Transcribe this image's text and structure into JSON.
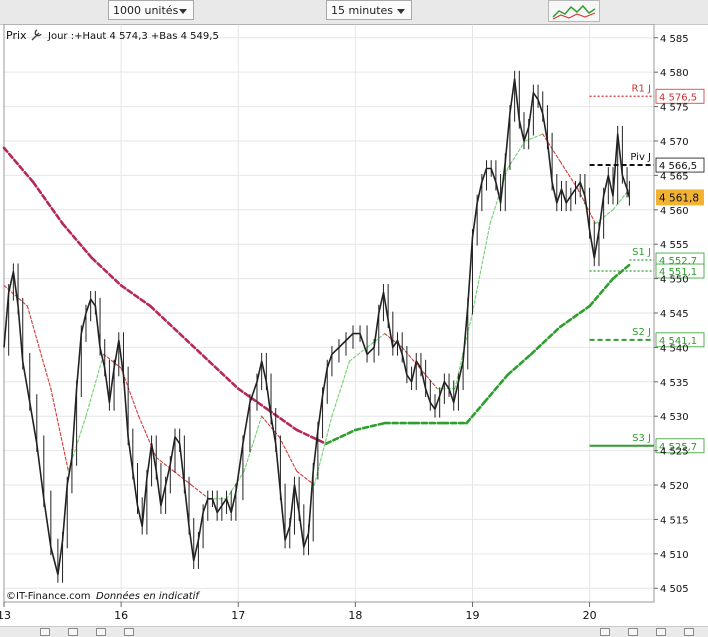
{
  "toolbar": {
    "quantity_select": "1000 unités",
    "interval_select": "15 minutes"
  },
  "chart_data": {
    "type": "candlestick",
    "header": "Jour :+Haut 4 574,3 +Bas 4 549,5",
    "prix_label": "Prix",
    "watermark": "©IT-Finance.com",
    "watermark_note": "Données en indicatif",
    "x_labels": [
      {
        "label": "13",
        "t": 0
      },
      {
        "label": "16",
        "t": 1
      },
      {
        "label": "17",
        "t": 2
      },
      {
        "label": "18",
        "t": 3
      },
      {
        "label": "19",
        "t": 4
      },
      {
        "label": "20",
        "t": 5
      }
    ],
    "x_range": [
      0,
      5.55
    ],
    "y_range": [
      4503,
      4587
    ],
    "y_ticks": [
      "4 505",
      "4 510",
      "4 515",
      "4 520",
      "4 525",
      "4 530",
      "4 535",
      "4 540",
      "4 545",
      "4 550",
      "4 555",
      "4 560",
      "4 565",
      "4 570",
      "4 575",
      "4 580",
      "4 585"
    ],
    "y_tick_values": [
      4505,
      4510,
      4515,
      4520,
      4525,
      4530,
      4535,
      4540,
      4545,
      4550,
      4555,
      4560,
      4565,
      4570,
      4575,
      4580,
      4585
    ],
    "price_path": [
      [
        0.0,
        4540
      ],
      [
        0.04,
        4548
      ],
      [
        0.08,
        4551
      ],
      [
        0.12,
        4546
      ],
      [
        0.16,
        4538
      ],
      [
        0.22,
        4532
      ],
      [
        0.28,
        4526
      ],
      [
        0.34,
        4518
      ],
      [
        0.4,
        4511
      ],
      [
        0.46,
        4507
      ],
      [
        0.5,
        4512
      ],
      [
        0.54,
        4520
      ],
      [
        0.58,
        4524
      ],
      [
        0.62,
        4534
      ],
      [
        0.66,
        4542
      ],
      [
        0.7,
        4545
      ],
      [
        0.74,
        4547
      ],
      [
        0.78,
        4546
      ],
      [
        0.82,
        4540
      ],
      [
        0.86,
        4537
      ],
      [
        0.9,
        4532
      ],
      [
        0.94,
        4537
      ],
      [
        0.98,
        4541
      ],
      [
        1.02,
        4536
      ],
      [
        1.06,
        4527
      ],
      [
        1.1,
        4522
      ],
      [
        1.14,
        4517
      ],
      [
        1.18,
        4514
      ],
      [
        1.22,
        4521
      ],
      [
        1.26,
        4526
      ],
      [
        1.3,
        4522
      ],
      [
        1.34,
        4517
      ],
      [
        1.38,
        4520
      ],
      [
        1.42,
        4523
      ],
      [
        1.46,
        4527
      ],
      [
        1.5,
        4526
      ],
      [
        1.54,
        4520
      ],
      [
        1.58,
        4514
      ],
      [
        1.62,
        4509
      ],
      [
        1.66,
        4512
      ],
      [
        1.7,
        4516
      ],
      [
        1.74,
        4518
      ],
      [
        1.78,
        4518
      ],
      [
        1.82,
        4516
      ],
      [
        1.86,
        4517
      ],
      [
        1.9,
        4518
      ],
      [
        1.94,
        4516
      ],
      [
        1.98,
        4519
      ],
      [
        2.04,
        4526
      ],
      [
        2.1,
        4532
      ],
      [
        2.16,
        4535
      ],
      [
        2.2,
        4538
      ],
      [
        2.24,
        4535
      ],
      [
        2.28,
        4530
      ],
      [
        2.32,
        4526
      ],
      [
        2.36,
        4519
      ],
      [
        2.4,
        4512
      ],
      [
        2.44,
        4514
      ],
      [
        2.48,
        4520
      ],
      [
        2.52,
        4516
      ],
      [
        2.56,
        4511
      ],
      [
        2.6,
        4513
      ],
      [
        2.64,
        4522
      ],
      [
        2.68,
        4528
      ],
      [
        2.72,
        4533
      ],
      [
        2.76,
        4537
      ],
      [
        2.8,
        4539
      ],
      [
        2.86,
        4540
      ],
      [
        2.92,
        4541
      ],
      [
        2.98,
        4542
      ],
      [
        3.04,
        4542
      ],
      [
        3.1,
        4539
      ],
      [
        3.16,
        4540
      ],
      [
        3.2,
        4545
      ],
      [
        3.24,
        4548
      ],
      [
        3.28,
        4544
      ],
      [
        3.32,
        4540
      ],
      [
        3.36,
        4541
      ],
      [
        3.4,
        4539
      ],
      [
        3.44,
        4536
      ],
      [
        3.48,
        4535
      ],
      [
        3.52,
        4538
      ],
      [
        3.56,
        4537
      ],
      [
        3.6,
        4534
      ],
      [
        3.64,
        4532
      ],
      [
        3.68,
        4531
      ],
      [
        3.72,
        4533
      ],
      [
        3.76,
        4535
      ],
      [
        3.8,
        4534
      ],
      [
        3.84,
        4532
      ],
      [
        3.88,
        4535
      ],
      [
        3.92,
        4538
      ],
      [
        3.96,
        4546
      ],
      [
        4.0,
        4556
      ],
      [
        4.04,
        4561
      ],
      [
        4.08,
        4564
      ],
      [
        4.12,
        4566
      ],
      [
        4.16,
        4566
      ],
      [
        4.2,
        4564
      ],
      [
        4.24,
        4561
      ],
      [
        4.28,
        4567
      ],
      [
        4.32,
        4574
      ],
      [
        4.36,
        4579
      ],
      [
        4.4,
        4573
      ],
      [
        4.44,
        4570
      ],
      [
        4.48,
        4572
      ],
      [
        4.52,
        4577
      ],
      [
        4.56,
        4576
      ],
      [
        4.6,
        4574
      ],
      [
        4.64,
        4570
      ],
      [
        4.68,
        4564
      ],
      [
        4.72,
        4561
      ],
      [
        4.76,
        4563
      ],
      [
        4.8,
        4561
      ],
      [
        4.84,
        4562
      ],
      [
        4.88,
        4563
      ],
      [
        4.92,
        4564
      ],
      [
        4.96,
        4562
      ],
      [
        5.0,
        4557
      ],
      [
        5.04,
        4553
      ],
      [
        5.08,
        4557
      ],
      [
        5.12,
        4562
      ],
      [
        5.16,
        4565
      ],
      [
        5.2,
        4562
      ],
      [
        5.24,
        4571
      ],
      [
        5.28,
        4565
      ],
      [
        5.32,
        4563
      ],
      [
        5.34,
        4561.8
      ]
    ],
    "ma_slow": [
      [
        0.0,
        4569
      ],
      [
        0.25,
        4564
      ],
      [
        0.5,
        4558
      ],
      [
        0.75,
        4553
      ],
      [
        1.0,
        4549
      ],
      [
        1.25,
        4546
      ],
      [
        1.5,
        4542
      ],
      [
        1.75,
        4538
      ],
      [
        2.0,
        4534
      ],
      [
        2.25,
        4531
      ],
      [
        2.5,
        4528
      ],
      [
        2.75,
        4526
      ],
      [
        3.0,
        4528
      ],
      [
        3.25,
        4529
      ],
      [
        3.5,
        4529
      ],
      [
        3.75,
        4529
      ],
      [
        3.95,
        4529
      ],
      [
        4.1,
        4532
      ],
      [
        4.3,
        4536
      ],
      [
        4.5,
        4539
      ],
      [
        4.75,
        4543
      ],
      [
        5.0,
        4546
      ],
      [
        5.2,
        4550
      ],
      [
        5.34,
        4552
      ]
    ],
    "ma_fast": [
      [
        0.0,
        4549
      ],
      [
        0.2,
        4546
      ],
      [
        0.4,
        4534
      ],
      [
        0.55,
        4522
      ],
      [
        0.7,
        4530
      ],
      [
        0.85,
        4539
      ],
      [
        1.0,
        4537
      ],
      [
        1.15,
        4530
      ],
      [
        1.3,
        4524
      ],
      [
        1.45,
        4522
      ],
      [
        1.6,
        4520
      ],
      [
        1.75,
        4518
      ],
      [
        1.9,
        4518
      ],
      [
        2.05,
        4522
      ],
      [
        2.2,
        4530
      ],
      [
        2.35,
        4527
      ],
      [
        2.5,
        4522
      ],
      [
        2.65,
        4520
      ],
      [
        2.8,
        4530
      ],
      [
        2.95,
        4538
      ],
      [
        3.1,
        4540
      ],
      [
        3.25,
        4542
      ],
      [
        3.4,
        4540
      ],
      [
        3.55,
        4537
      ],
      [
        3.7,
        4534
      ],
      [
        3.85,
        4534
      ],
      [
        4.0,
        4545
      ],
      [
        4.15,
        4558
      ],
      [
        4.3,
        4566
      ],
      [
        4.45,
        4570
      ],
      [
        4.6,
        4571
      ],
      [
        4.75,
        4567
      ],
      [
        4.9,
        4563
      ],
      [
        5.05,
        4558
      ],
      [
        5.2,
        4560
      ],
      [
        5.34,
        4563
      ]
    ],
    "levels": [
      {
        "label": "R1 J",
        "value": 4576.5,
        "display": "4 576,5",
        "color": "#cc3333",
        "style": "dotted",
        "x_start": 5.0
      },
      {
        "label": "Piv J",
        "value": 4566.5,
        "display": "4 566,5",
        "color": "#111111",
        "style": "dashed",
        "x_start": 5.0
      },
      {
        "label": "S1 J",
        "value": 4552.7,
        "display": "4 552,7",
        "color": "#2e9e2e",
        "style": "dotted",
        "x_start": 5.34
      },
      {
        "label": "",
        "value": 4551.1,
        "display": "4 551,1",
        "color": "#2e9e2e",
        "style": "dotted",
        "x_start": 5.0
      },
      {
        "label": "S2 J",
        "value": 4541.1,
        "display": "4 541,1",
        "color": "#2e9e2e",
        "style": "dashed",
        "x_start": 5.0
      },
      {
        "label": "S3 J",
        "value": 4525.7,
        "display": "4 525,7",
        "color": "#2e9e2e",
        "style": "solid",
        "x_start": 5.0
      }
    ],
    "current_price": {
      "value": 4561.8,
      "display": "4 561,8",
      "bg": "#f2b233"
    },
    "colors": {
      "price": "#222222",
      "ma_slow_down": "#b5285a",
      "ma_slow_up": "#2e9e2e",
      "ma_fast_down": "#d83a3a",
      "ma_fast_up": "#6fd36f",
      "grid": "#e6e6e6",
      "frame": "#9a9a9a"
    }
  }
}
